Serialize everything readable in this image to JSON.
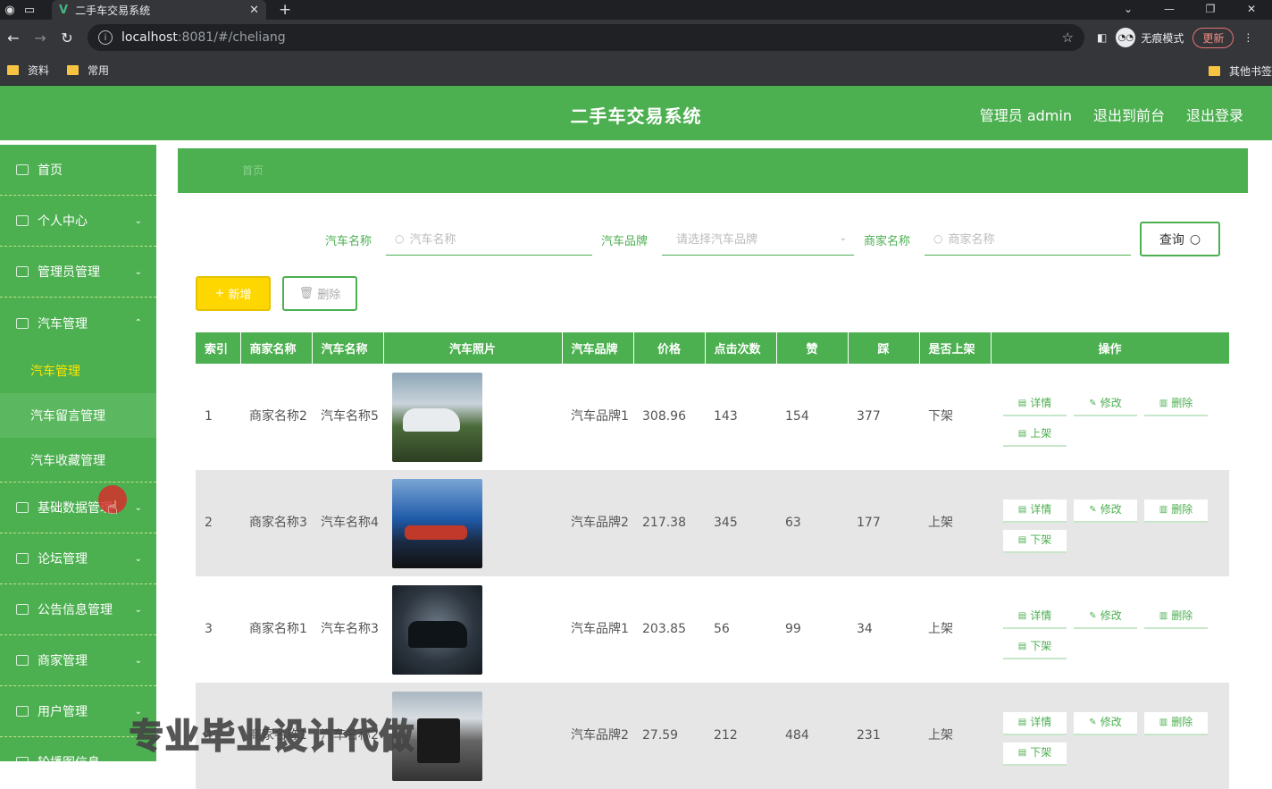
{
  "browser": {
    "tab_title": "二手车交易系统",
    "url_host": "localhost",
    "url_path": ":8081/#/cheliang",
    "incognito_label": "无痕模式",
    "update_label": "更新",
    "bookmarks": [
      "资料",
      "常用"
    ],
    "other_bookmarks": "其他书签"
  },
  "header": {
    "title": "二手车交易系统",
    "admin": "管理员 admin",
    "to_front": "退出到前台",
    "logout": "退出登录"
  },
  "sidebar": {
    "items": [
      {
        "label": "首页",
        "chevron": ""
      },
      {
        "label": "个人中心",
        "chevron": "⌄"
      },
      {
        "label": "管理员管理",
        "chevron": "⌄"
      },
      {
        "label": "汽车管理",
        "chevron": "⌃"
      }
    ],
    "sub_items": [
      "汽车管理",
      "汽车留言管理",
      "汽车收藏管理"
    ],
    "items_after": [
      {
        "label": "基础数据管理",
        "chevron": "⌄"
      },
      {
        "label": "论坛管理",
        "chevron": "⌄"
      },
      {
        "label": "公告信息管理",
        "chevron": "⌄"
      },
      {
        "label": "商家管理",
        "chevron": "⌄"
      },
      {
        "label": "用户管理",
        "chevron": "⌄"
      },
      {
        "label": "轮播图信息",
        "chevron": "⌄"
      }
    ]
  },
  "breadcrumb": "首页",
  "search": {
    "car_name_label": "汽车名称",
    "car_name_placeholder": "汽车名称",
    "brand_label": "汽车品牌",
    "brand_placeholder": "请选择汽车品牌",
    "merchant_label": "商家名称",
    "merchant_placeholder": "商家名称",
    "query_button": "查询"
  },
  "actions": {
    "add": "新增",
    "delete": "删除"
  },
  "table": {
    "headers": [
      "索引",
      "商家名称",
      "汽车名称",
      "汽车照片",
      "汽车品牌",
      "价格",
      "点击次数",
      "赞",
      "踩",
      "是否上架",
      "操作"
    ],
    "rows": [
      {
        "index": "1",
        "merchant": "商家名称2",
        "car": "汽车名称5",
        "brand": "汽车品牌1",
        "price": "308.96",
        "clicks": "143",
        "likes": "154",
        "dislikes": "377",
        "status": "下架",
        "toggle": "上架"
      },
      {
        "index": "2",
        "merchant": "商家名称3",
        "car": "汽车名称4",
        "brand": "汽车品牌2",
        "price": "217.38",
        "clicks": "345",
        "likes": "63",
        "dislikes": "177",
        "status": "上架",
        "toggle": "下架"
      },
      {
        "index": "3",
        "merchant": "商家名称1",
        "car": "汽车名称3",
        "brand": "汽车品牌1",
        "price": "203.85",
        "clicks": "56",
        "likes": "99",
        "dislikes": "34",
        "status": "上架",
        "toggle": "下架"
      },
      {
        "index": "4",
        "merchant": "商家名称1",
        "car": "汽车名称2",
        "brand": "汽车品牌2",
        "price": "27.59",
        "clicks": "212",
        "likes": "484",
        "dislikes": "231",
        "status": "上架",
        "toggle": "下架"
      }
    ],
    "op_detail": "详情",
    "op_edit": "修改",
    "op_delete": "删除"
  },
  "watermark": "专业毕业设计代做"
}
